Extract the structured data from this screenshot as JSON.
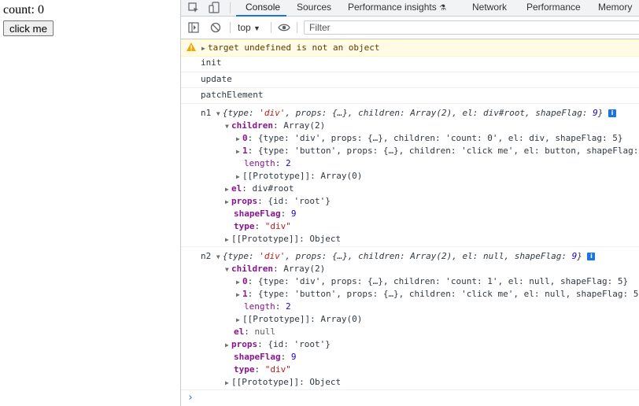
{
  "page": {
    "count_text": "count: 0",
    "button_label": "click me"
  },
  "devtools": {
    "tabs": [
      "Console",
      "Sources",
      "Performance insights",
      "Network",
      "Performance",
      "Memory"
    ],
    "toolbar": {
      "context": "top",
      "filter_placeholder": "Filter"
    },
    "warning": "target undefined is not an object",
    "logs": [
      "init",
      "update",
      "patchElement"
    ],
    "n1": {
      "label": "n1",
      "summary_pre": "{type: ",
      "summary_type": "'div'",
      "summary_mid": ", props: {…}, children: Array(2), el: div#root, shapeFlag: ",
      "summary_flag": "9",
      "summary_post": "}",
      "children_key": "children",
      "children_val": "Array(2)",
      "child0_idx": "0",
      "child0": "{type: 'div', props: {…}, children: 'count: 0', el: div, shapeFlag: 5}",
      "child1_idx": "1",
      "child1": "{type: 'button', props: {…}, children: 'click me', el: button, shapeFlag: ",
      "length_key": "length",
      "length_val": "2",
      "proto_arr": "[[Prototype]]: Array(0)",
      "el_key": "el",
      "el_val": "div#root",
      "props_key": "props",
      "props_val": "{id: 'root'}",
      "shape_key": "shapeFlag",
      "shape_val": "9",
      "type_key": "type",
      "type_val": "\"div\"",
      "proto_obj": "[[Prototype]]: Object"
    },
    "n2": {
      "label": "n2",
      "summary_pre": "{type: ",
      "summary_type": "'div'",
      "summary_mid": ", props: {…}, children: Array(2), el: null, shapeFlag: ",
      "summary_flag": "9",
      "summary_post": "}",
      "children_key": "children",
      "children_val": "Array(2)",
      "child0_idx": "0",
      "child0": "{type: 'div', props: {…}, children: 'count: 1', el: null, shapeFlag: 5}",
      "child1_idx": "1",
      "child1": "{type: 'button', props: {…}, children: 'click me', el: null, shapeFlag: 5",
      "length_key": "length",
      "length_val": "2",
      "proto_arr": "[[Prototype]]: Array(0)",
      "el_key": "el",
      "el_val": "null",
      "props_key": "props",
      "props_val": "{id: 'root'}",
      "shape_key": "shapeFlag",
      "shape_val": "9",
      "type_key": "type",
      "type_val": "\"div\"",
      "proto_obj": "[[Prototype]]: Object"
    },
    "prompt": "›"
  }
}
